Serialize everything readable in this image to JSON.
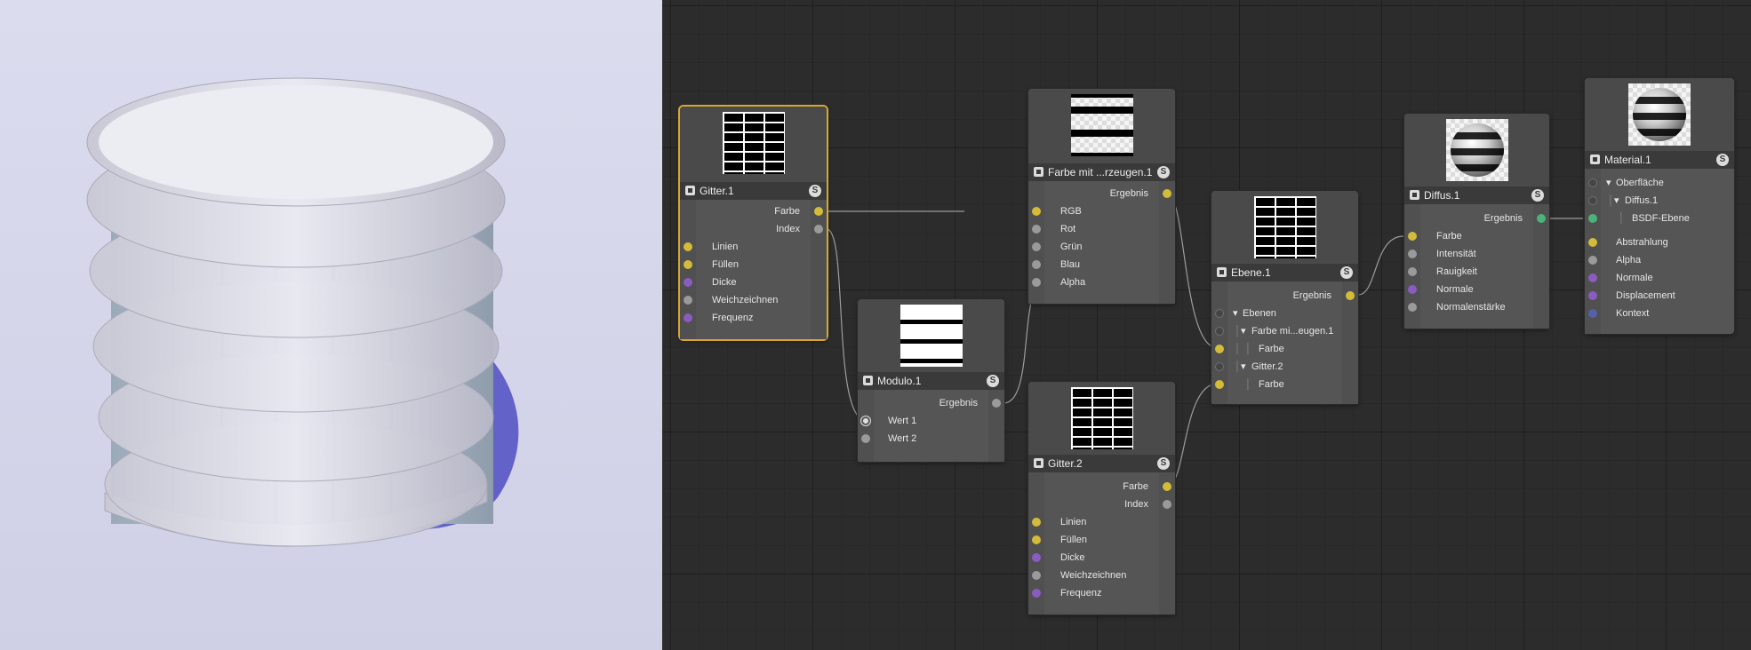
{
  "nodes": {
    "gitter1": {
      "title": "Gitter.1",
      "outputs": [
        "Farbe",
        "Index"
      ],
      "inputs": [
        "Linien",
        "Füllen",
        "Dicke",
        "Weichzeichnen",
        "Frequenz"
      ]
    },
    "modulo1": {
      "title": "Modulo.1",
      "outputs": [
        "Ergebnis"
      ],
      "inputs": [
        "Wert 1",
        "Wert 2"
      ]
    },
    "farbe1": {
      "title": "Farbe mit ...rzeugen.1",
      "outputs": [
        "Ergebnis"
      ],
      "inputs": [
        "RGB",
        "Rot",
        "Grün",
        "Blau",
        "Alpha"
      ]
    },
    "gitter2": {
      "title": "Gitter.2",
      "outputs": [
        "Farbe",
        "Index"
      ],
      "inputs": [
        "Linien",
        "Füllen",
        "Dicke",
        "Weichzeichnen",
        "Frequenz"
      ]
    },
    "ebene1": {
      "title": "Ebene.1",
      "outputs": [
        "Ergebnis"
      ],
      "tree": [
        "Ebenen",
        "Farbe mi...eugen.1",
        "Farbe",
        "Gitter.2",
        "Farbe"
      ]
    },
    "diffus1": {
      "title": "Diffus.1",
      "outputs": [
        "Ergebnis"
      ],
      "inputs": [
        "Farbe",
        "Intensität",
        "Rauigkeit",
        "Normale",
        "Normalenstärke"
      ]
    },
    "material1": {
      "title": "Material.1",
      "tree": [
        "Oberfläche",
        "Diffus.1",
        "BSDF-Ebene"
      ],
      "inputs": [
        "Abstrahlung",
        "Alpha",
        "Normale",
        "Displacement",
        "Kontext"
      ]
    }
  },
  "badge": "S",
  "colors": {
    "selection": "#d9a72f",
    "wire": "#9d9d9d",
    "port_color": "#d4bb39",
    "port_float": "#9a9a9a",
    "port_vector": "#8a5cc0",
    "port_bsdf": "#4db27a",
    "port_context": "#5560a8"
  }
}
